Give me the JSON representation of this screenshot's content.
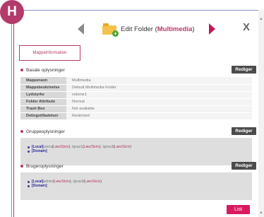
{
  "badge": {
    "letter": "H"
  },
  "header": {
    "title_prefix": "Edit Folder (",
    "title_highlight": "Multimedia",
    "title_suffix": ")",
    "close_label": "X"
  },
  "tabs": {
    "mappe": "Mappeinformation"
  },
  "basic": {
    "title": "Basale oplysninger",
    "edit_label": "Rediger",
    "rows": [
      {
        "key": "Mappenavn",
        "value": "Multimedia"
      },
      {
        "key": "Mappebeskrivelse",
        "value": "Default Multimedia Folder"
      },
      {
        "key": "Lydstyrke",
        "value": "volume1"
      },
      {
        "key": "Folder Attribute",
        "value": "Normal"
      },
      {
        "key": "Trash Box",
        "value": "Not available"
      },
      {
        "key": "Delingstilladelser",
        "value": "Restricted"
      }
    ]
  },
  "groups": {
    "title": "Gruppeoplysninger",
    "edit_label": "Rediger",
    "line1": {
      "scope": "[Local]",
      "m1_name": "users",
      "m1_perm": "Læs/Skriv",
      "sep1": ", ",
      "m2_name": "Ignas1",
      "m2_perm": "Læs/Skriv",
      "sep2": ", ",
      "m3_name": "Ignas3",
      "m3_perm": "Læs/Skriv"
    },
    "line2": {
      "scope": "[Domain]"
    }
  },
  "users": {
    "title": "Brugeroplysninger",
    "edit_label": "Rediger",
    "line1": {
      "scope": "[Local]",
      "m1_name": "admin",
      "m1_perm": "Læs/Skriv",
      "sep1": ", ",
      "m2_name": "Ignas5",
      "m2_perm": "Læs/Skriv"
    },
    "line2": {
      "scope": "[Domain]"
    }
  },
  "footer": {
    "list_label": "List"
  },
  "colors": {
    "accent": "#b43a6b",
    "button_dark": "#4b4b4b",
    "list_button": "#d81b60",
    "link_blue": "#2a2a9a"
  }
}
